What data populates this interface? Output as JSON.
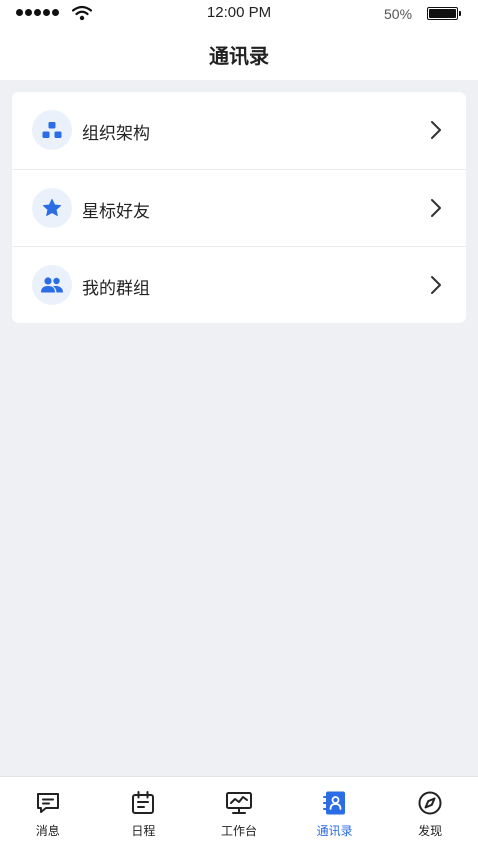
{
  "status_bar": {
    "time": "12:00 PM",
    "battery_percent": "50%",
    "battery_level": 1.0
  },
  "header": {
    "title": "通讯录"
  },
  "contacts_menu": {
    "items": [
      {
        "label": "组织架构",
        "icon": "org-chart-icon"
      },
      {
        "label": "星标好友",
        "icon": "star-icon"
      },
      {
        "label": "我的群组",
        "icon": "group-icon"
      }
    ]
  },
  "tab_bar": {
    "active_index": 3,
    "accent_color": "#2b6de5",
    "items": [
      {
        "label": "消息",
        "icon": "message-icon"
      },
      {
        "label": "日程",
        "icon": "calendar-icon"
      },
      {
        "label": "工作台",
        "icon": "workbench-icon"
      },
      {
        "label": "通讯录",
        "icon": "contacts-book-icon"
      },
      {
        "label": "发现",
        "icon": "compass-icon"
      }
    ]
  }
}
